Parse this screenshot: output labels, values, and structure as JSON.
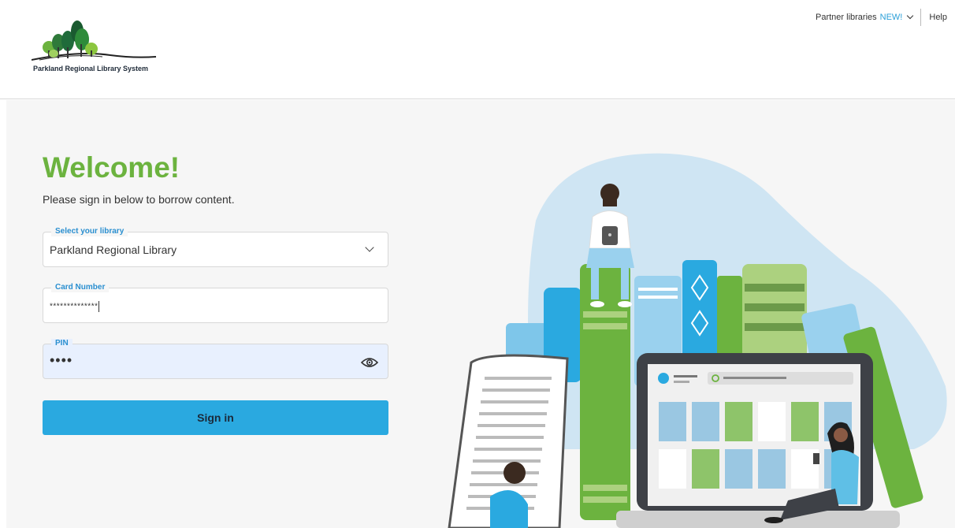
{
  "header": {
    "logo_text": "Parkland Regional Library System",
    "partner_label": "Partner libraries",
    "new_badge": "NEW!",
    "help_label": "Help"
  },
  "main": {
    "title": "Welcome!",
    "subtitle": "Please sign in below to borrow content."
  },
  "form": {
    "library": {
      "label": "Select your library",
      "value": "Parkland Regional Library"
    },
    "card": {
      "label": "Card Number",
      "value": "**************"
    },
    "pin": {
      "label": "PIN",
      "value": "••••"
    },
    "signin_label": "Sign in"
  },
  "colors": {
    "accent_green": "#6cb33f",
    "button_blue": "#2aa9e0",
    "label_blue": "#2a8fd0"
  },
  "icons": {
    "dropdown": "chevron-down-icon",
    "password": "eye-icon"
  }
}
